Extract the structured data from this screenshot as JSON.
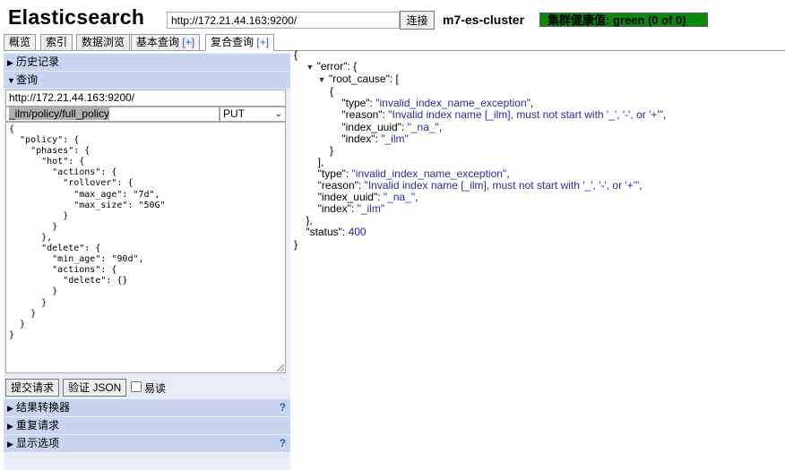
{
  "header": {
    "app_title": "Elasticsearch",
    "url": "http://172.21.44.163:9200/",
    "connect_label": "连接",
    "cluster_name": "m7-es-cluster",
    "health": "集群健康值: green (0 of 0)",
    "health_color": "#0a8a0a"
  },
  "tabs": [
    {
      "label": "概览"
    },
    {
      "label": "索引"
    },
    {
      "label": "数据浏览"
    },
    {
      "label": "基本查询",
      "plus": "[+]"
    },
    {
      "label": "复合查询",
      "plus": "[+]"
    }
  ],
  "left": {
    "history_label": "历史记录",
    "query_label": "查询",
    "query_url": "http://172.21.44.163:9200/",
    "query_path": "_ilm/policy/full_policy",
    "method": "PUT",
    "body": "{\n  \"policy\": {\n    \"phases\": {\n      \"hot\": {\n        \"actions\": {\n          \"rollover\": {\n            \"max_age\": \"7d\",\n            \"max_size\": \"50G\"\n          }\n        }\n      },\n      \"delete\": {\n        \"min_age\": \"90d\",\n        \"actions\": {\n          \"delete\": {}\n        }\n      }\n    }\n  }\n}",
    "submit_label": "提交请求",
    "validate_label": "验证 JSON",
    "easy_read_label": "易读",
    "result_transformer_label": "结果转换器",
    "repeat_label": "重复请求",
    "display_options_label": "显示选项",
    "help": "?"
  },
  "result": {
    "open": "{",
    "error_key": "\"error\"",
    "root_cause_key": "\"root_cause\"",
    "type_key": "\"type\"",
    "type_val": "\"invalid_index_name_exception\"",
    "reason_key": "\"reason\"",
    "reason_val": "\"Invalid index name [_ilm], must not start with '_', '-', or '+'\"",
    "index_uuid_key": "\"index_uuid\"",
    "index_uuid_val": "\"_na_\"",
    "index_key": "\"index\"",
    "index_val": "\"_ilm\"",
    "status_key": "\"status\"",
    "status_val": "400",
    "close": "}"
  }
}
